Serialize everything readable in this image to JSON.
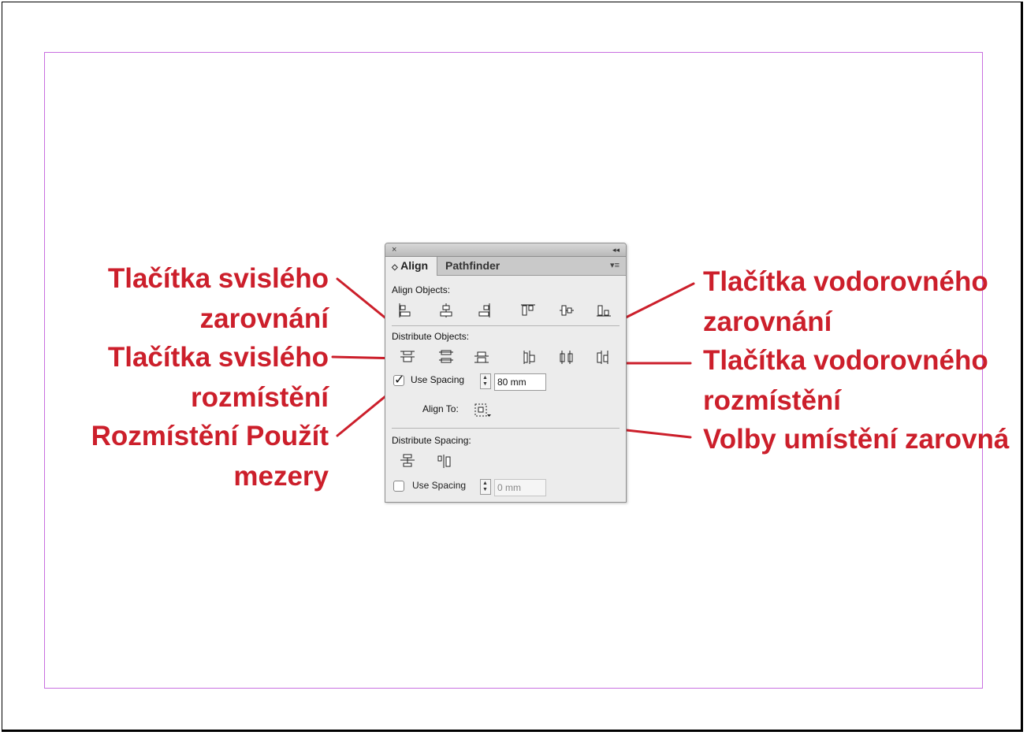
{
  "panel": {
    "close_glyph": "×",
    "collapse_glyph": "◂◂",
    "tabs": [
      {
        "label": "Align",
        "active": true,
        "prefix": "◇"
      },
      {
        "label": "Pathfinder",
        "active": false
      }
    ],
    "menu_glyph": "▾≡",
    "align_objects_label": "Align Objects:",
    "distribute_objects_label": "Distribute Objects:",
    "use_spacing_label": "Use Spacing",
    "use_spacing_checked": true,
    "use_spacing_value": "80 mm",
    "align_to_label": "Align To:",
    "distribute_spacing_label": "Distribute Spacing:",
    "use_spacing_2_label": "Use Spacing",
    "use_spacing_2_checked": false,
    "use_spacing_2_value": "0 mm"
  },
  "callouts": {
    "vertical_align": [
      "Tlačítka svislého",
      "zarovnání"
    ],
    "vertical_distribute": [
      "Tlačítka svislého",
      "rozmístění"
    ],
    "distribute_spacing": [
      "Rozmístění Použít",
      "mezery"
    ],
    "horizontal_align": [
      "Tlačítka vodorovného",
      "zarovnání"
    ],
    "horizontal_distribute": [
      "Tlačítka vodorovného",
      "rozmístění"
    ],
    "align_to_options": [
      "Volby umístění zarovná"
    ]
  },
  "colors": {
    "callout": "#cc1f2b",
    "margin_guide": "#c86fe0"
  }
}
